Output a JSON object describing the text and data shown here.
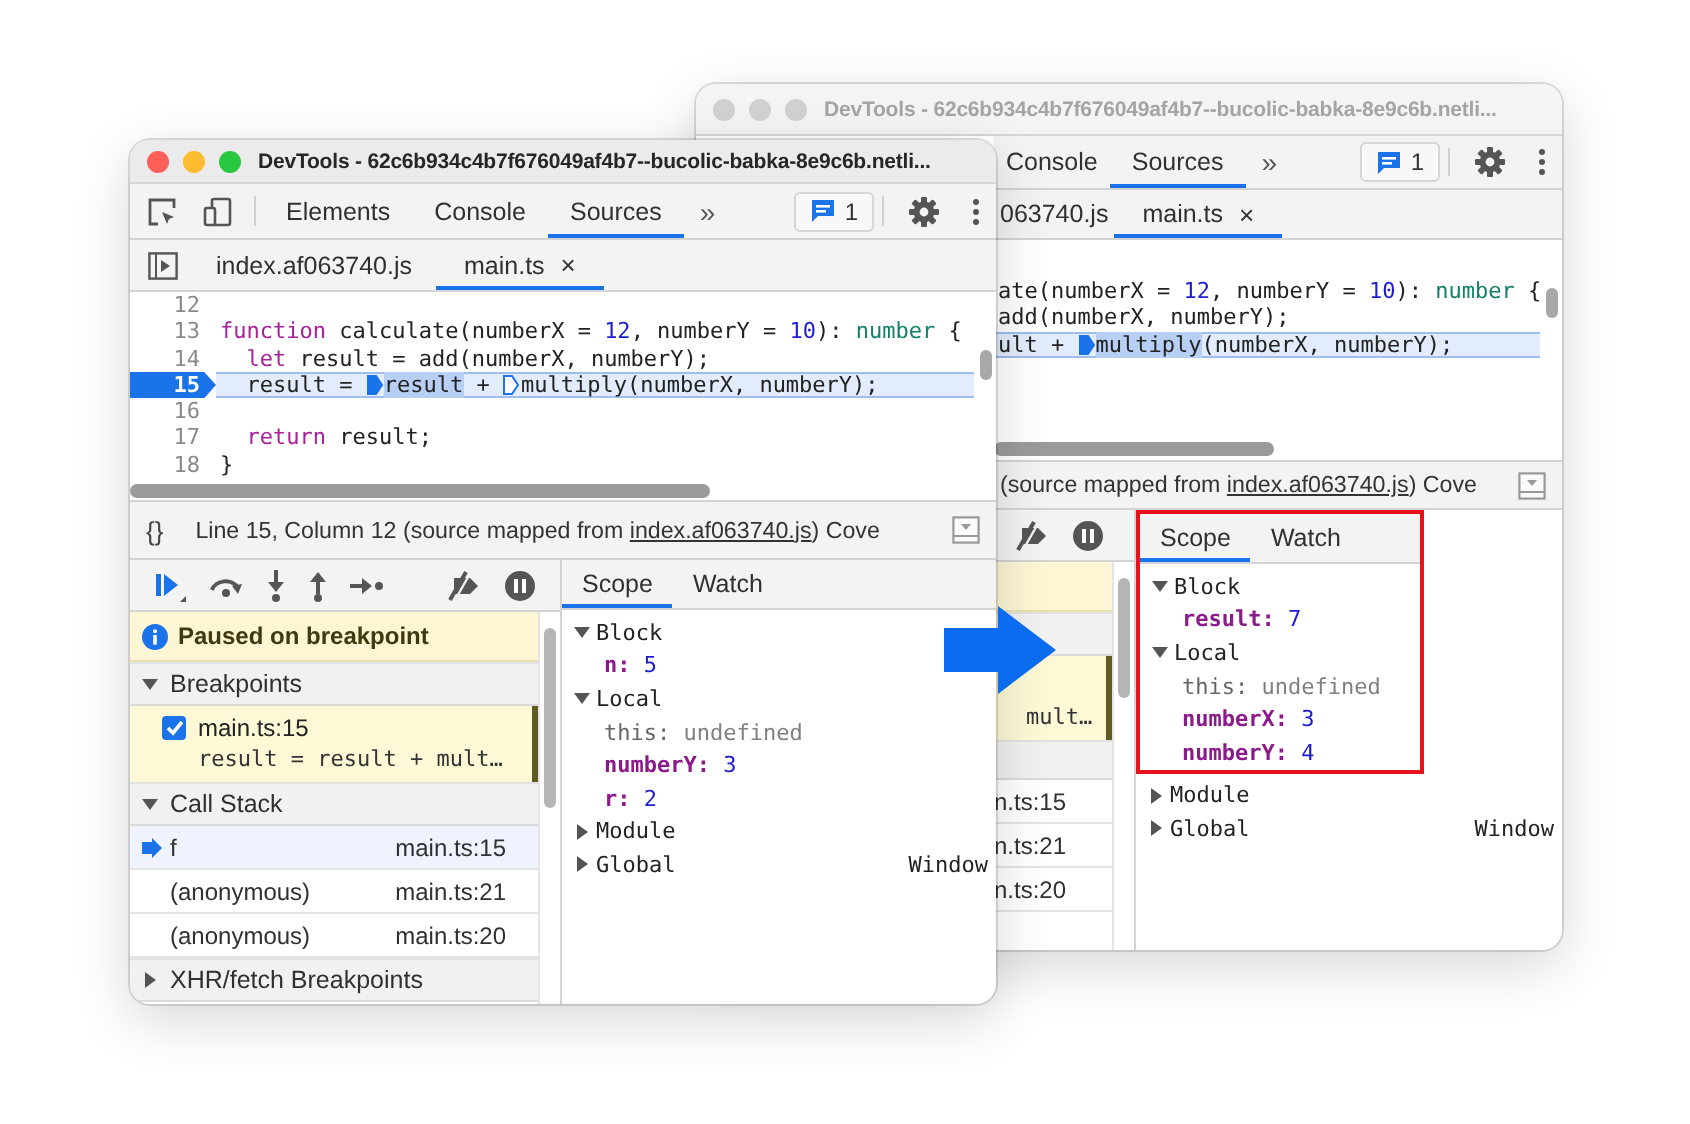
{
  "back_window": {
    "title": "DevTools - 62c6b934c4b7f676049af4b7--bucolic-babka-8e9c6b.netli...",
    "active": false,
    "panel_tabs": [
      {
        "label": "Console",
        "selected": false
      },
      {
        "label": "Sources",
        "selected": true
      }
    ],
    "more_tabs": "»",
    "issues_count": "1",
    "file_tabs": [
      {
        "label": "063740.js",
        "selected": false,
        "closable": false
      },
      {
        "label": "main.ts",
        "selected": true,
        "closable": true
      }
    ],
    "close_glyph": "×",
    "code_lines": [
      {
        "current": false,
        "tokens": [
          {
            "kind": "plain",
            "text": "ate(numberX = "
          },
          {
            "kind": "number",
            "text": "12"
          },
          {
            "kind": "plain",
            "text": ", numberY = "
          },
          {
            "kind": "number",
            "text": "10"
          },
          {
            "kind": "plain",
            "text": "): "
          },
          {
            "kind": "type",
            "text": "number"
          },
          {
            "kind": "plain",
            "text": " {"
          }
        ]
      },
      {
        "current": false,
        "tokens": [
          {
            "kind": "plain",
            "text": "add(numberX, numberY);"
          }
        ]
      },
      {
        "current": true,
        "tokens": [
          {
            "kind": "plain",
            "text": "ult + "
          },
          {
            "kind": "marker_active"
          },
          {
            "kind": "selected",
            "text": "multiply"
          },
          {
            "kind": "plain",
            "text": "(numberX, numberY);"
          }
        ]
      }
    ],
    "status": {
      "before": "(source mapped from ",
      "link": "index.af063740.js",
      "after": ")  Cove"
    },
    "sidebar": {
      "breakpoint_code": "mult…",
      "frame_locations": [
        "n.ts:15",
        "n.ts:21",
        "n.ts:20"
      ]
    },
    "scope": {
      "tabs": [
        {
          "label": "Scope",
          "selected": true
        },
        {
          "label": "Watch",
          "selected": false
        }
      ],
      "tree": [
        {
          "kind": "scope",
          "name": "Block",
          "expanded": true,
          "highlighted": true,
          "children": [
            {
              "kind": "variable",
              "name": "result:",
              "value": "7"
            }
          ]
        },
        {
          "kind": "scope",
          "name": "Local",
          "expanded": true,
          "highlighted": true,
          "children": [
            {
              "kind": "receiver",
              "name": "this:",
              "value": "undefined"
            },
            {
              "kind": "variable",
              "name": "numberX:",
              "value": "3"
            },
            {
              "kind": "variable",
              "name": "numberY:",
              "value": "4"
            }
          ]
        },
        {
          "kind": "scope",
          "name": "Module",
          "expanded": false,
          "highlighted": false
        },
        {
          "kind": "scope",
          "name": "Global",
          "expanded": false,
          "highlighted": false,
          "value": "Window"
        }
      ]
    }
  },
  "front_window": {
    "title": "DevTools - 62c6b934c4b7f676049af4b7--bucolic-babka-8e9c6b.netli...",
    "active": true,
    "panel_tabs": [
      {
        "label": "Elements",
        "selected": false
      },
      {
        "label": "Console",
        "selected": false
      },
      {
        "label": "Sources",
        "selected": true
      }
    ],
    "more_tabs": "»",
    "issues_count": "1",
    "file_tabs": [
      {
        "label": "index.af063740.js",
        "selected": false,
        "closable": false
      },
      {
        "label": "main.ts",
        "selected": true,
        "closable": true
      }
    ],
    "close_glyph": "×",
    "code_lines": [
      {
        "number": "12",
        "current": false
      },
      {
        "number": "13",
        "current": false,
        "tokens": [
          {
            "kind": "keyword",
            "text": "function"
          },
          {
            "kind": "plain",
            "text": " calculate(numberX = "
          },
          {
            "kind": "number",
            "text": "12"
          },
          {
            "kind": "plain",
            "text": ", numberY = "
          },
          {
            "kind": "number",
            "text": "10"
          },
          {
            "kind": "plain",
            "text": "): "
          },
          {
            "kind": "type",
            "text": "number"
          },
          {
            "kind": "plain",
            "text": " {"
          }
        ]
      },
      {
        "number": "14",
        "current": false,
        "tokens": [
          {
            "kind": "keyword",
            "text": "  let"
          },
          {
            "kind": "plain",
            "text": " result = add(numberX, numberY);"
          }
        ]
      },
      {
        "number": "15",
        "current": true,
        "tokens": [
          {
            "kind": "plain",
            "text": "  result = "
          },
          {
            "kind": "marker_active"
          },
          {
            "kind": "selected",
            "text": "result"
          },
          {
            "kind": "plain",
            "text": " + "
          },
          {
            "kind": "marker"
          },
          {
            "kind": "plain",
            "text": "multiply(numberX, numberY);"
          }
        ]
      },
      {
        "number": "16",
        "current": false
      },
      {
        "number": "17",
        "current": false,
        "tokens": [
          {
            "kind": "keyword",
            "text": "  return"
          },
          {
            "kind": "plain",
            "text": " result;"
          }
        ]
      },
      {
        "number": "18",
        "current": false,
        "tokens": [
          {
            "kind": "plain",
            "text": "}"
          }
        ]
      }
    ],
    "status": {
      "format": "{}",
      "before": "Line 15, Column 12  (source mapped from ",
      "link": "index.af063740.js",
      "after": ")  Cove"
    },
    "sidebar": {
      "paused_message": "Paused on breakpoint",
      "breakpoints": {
        "title": "Breakpoints",
        "expanded": true,
        "items": [
          {
            "location": "main.ts:15",
            "code": "result = result + mult…",
            "checked": true
          }
        ]
      },
      "call_stack": {
        "title": "Call Stack",
        "expanded": true,
        "frames": [
          {
            "name": "f",
            "location": "main.ts:15",
            "selected": true
          },
          {
            "name": "(anonymous)",
            "location": "main.ts:21",
            "selected": false
          },
          {
            "name": "(anonymous)",
            "location": "main.ts:20",
            "selected": false
          }
        ]
      },
      "xhr": {
        "title": "XHR/fetch Breakpoints",
        "expanded": false
      }
    },
    "scope": {
      "tabs": [
        {
          "label": "Scope",
          "selected": true
        },
        {
          "label": "Watch",
          "selected": false
        }
      ],
      "tree": [
        {
          "kind": "scope",
          "name": "Block",
          "expanded": true,
          "children": [
            {
              "kind": "variable",
              "name": "n:",
              "value": "5"
            }
          ]
        },
        {
          "kind": "scope",
          "name": "Local",
          "expanded": true,
          "children": [
            {
              "kind": "receiver",
              "name": "this:",
              "value": "undefined"
            },
            {
              "kind": "variable",
              "name": "numberY:",
              "value": "3"
            },
            {
              "kind": "variable",
              "name": "r:",
              "value": "2"
            }
          ]
        },
        {
          "kind": "scope",
          "name": "Module",
          "expanded": false
        },
        {
          "kind": "scope",
          "name": "Global",
          "expanded": false,
          "value": "Window"
        }
      ]
    }
  }
}
